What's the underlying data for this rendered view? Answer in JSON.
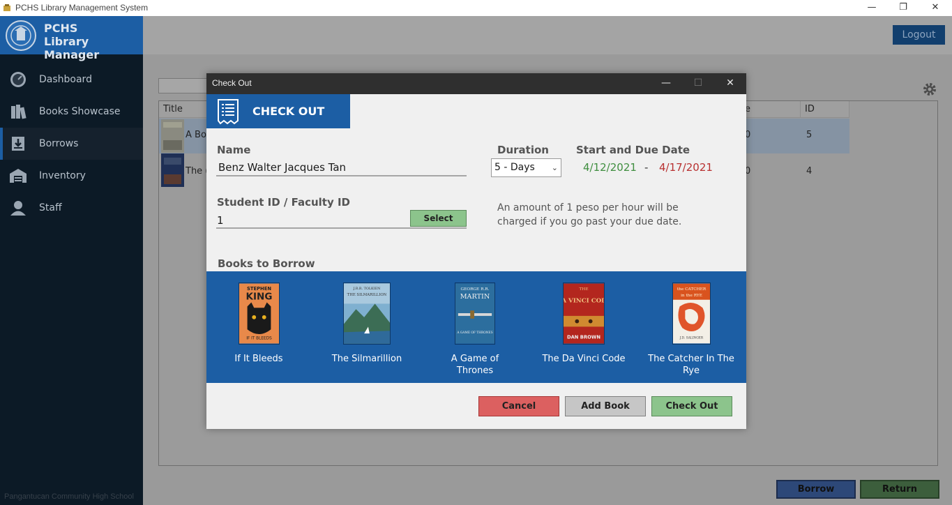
{
  "os_window": {
    "title": "PCHS Library Management System",
    "controls": {
      "minimize": "—",
      "restore": "❐",
      "close": "✕"
    }
  },
  "brand": {
    "line1": "PCHS",
    "line2": "Library Manager"
  },
  "sidebar": {
    "items": [
      {
        "label": "Dashboard",
        "icon": "dashboard-icon"
      },
      {
        "label": "Books Showcase",
        "icon": "books-icon"
      },
      {
        "label": "Borrows",
        "icon": "download-icon",
        "active": true
      },
      {
        "label": "Inventory",
        "icon": "warehouse-icon"
      },
      {
        "label": "Staff",
        "icon": "user-icon"
      }
    ],
    "footer": "Pangantucan Community High School"
  },
  "header": {
    "logout_label": "Logout"
  },
  "table": {
    "columns": {
      "title": "Title",
      "date_fragment": "e",
      "id": "ID"
    },
    "rows": [
      {
        "title_fragment": "A Bo",
        "mid_fragment": "0",
        "id": "5",
        "selected": true
      },
      {
        "title_fragment": "The (",
        "mid_fragment": "0",
        "id": "4",
        "selected": false
      }
    ]
  },
  "actions": {
    "borrow_label": "Borrow",
    "return_label": "Return"
  },
  "modal": {
    "window_title": "Check Out",
    "controls": {
      "minimize": "—",
      "maximize": "☐",
      "close": "✕"
    },
    "header_label": "CHECK OUT",
    "name_label": "Name",
    "name_value": "Benz Walter Jacques Tan",
    "id_label": "Student ID / Faculty ID",
    "id_value": "1",
    "select_label": "Select",
    "duration_label": "Duration",
    "duration_value": "5 - Days",
    "dates_label": "Start and Due Date",
    "start_date": "4/12/2021",
    "date_separator": "-",
    "due_date": "4/17/2021",
    "note_line1": "An amount of 1 peso per hour will be",
    "note_line2": "charged if you go past your due date.",
    "books_label": "Books to Borrow",
    "books": [
      {
        "title": "If It Bleeds",
        "cover_author": "STEPHEN",
        "cover_name": "KING",
        "cover_sub": "IF IT BLEEDS"
      },
      {
        "title": "The Silmarillion",
        "cover_author": "J.R.R. TOLKIEN",
        "cover_name": "THE SILMARILLION"
      },
      {
        "title": "A Game of Thrones",
        "title_line1": "A Game of",
        "title_line2": "Thrones",
        "cover_author": "GEORGE R.R.",
        "cover_name": "MARTIN",
        "cover_sub": "A GAME OF THRONES"
      },
      {
        "title": "The Da Vinci Code",
        "cover_author": "THE",
        "cover_name": "DA VINCI CODE",
        "cover_sub": "DAN BROWN"
      },
      {
        "title": "The Catcher In The Rye",
        "title_line1": "The Catcher In The",
        "title_line2": "Rye",
        "cover_author": "the CATCHER",
        "cover_name": "in the RYE",
        "cover_sub": "J.D. SALINGER"
      }
    ],
    "cancel_label": "Cancel",
    "add_book_label": "Add Book",
    "checkout_label": "Check Out"
  },
  "colors": {
    "brand_blue": "#1c5ea4",
    "sidebar_bg": "#0c1a26",
    "start_date": "#3f8e3f",
    "due_date": "#b83030",
    "cancel": "#dc6060",
    "checkout": "#8cc48c"
  }
}
